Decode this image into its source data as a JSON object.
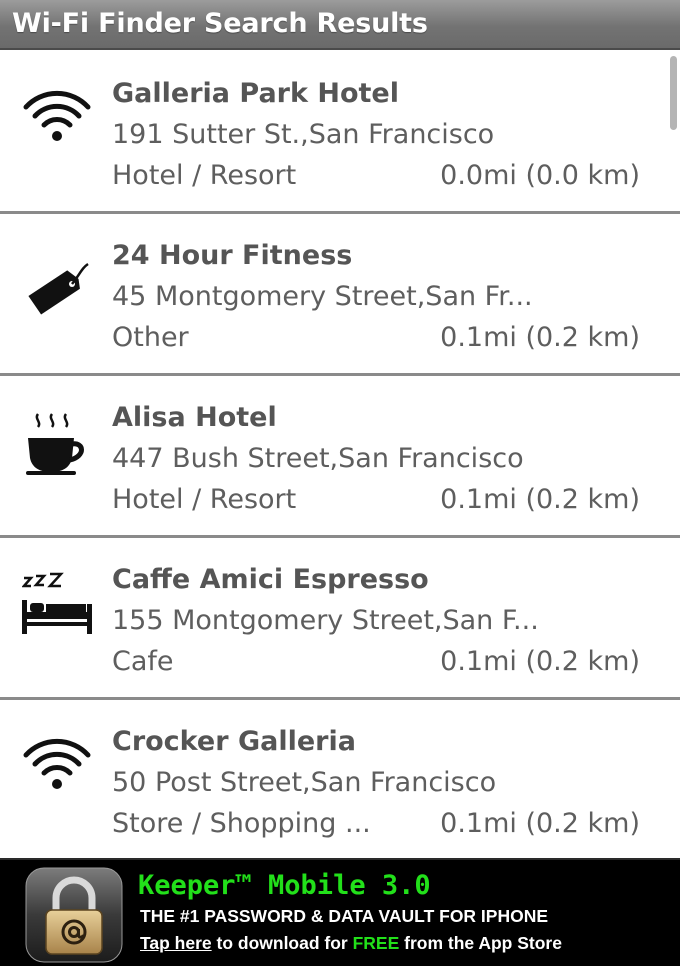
{
  "header": {
    "title": "Wi-Fi Finder Search Results"
  },
  "results": [
    {
      "icon": "wifi-icon",
      "name": "Galleria Park Hotel",
      "address": "191 Sutter St.,San Francisco",
      "category": "Hotel / Resort",
      "distance": "0.0mi (0.0 km)"
    },
    {
      "icon": "tag-icon",
      "name": "24 Hour Fitness",
      "address": "45 Montgomery Street,San Fr...",
      "category": "Other",
      "distance": "0.1mi (0.2 km)"
    },
    {
      "icon": "coffee-cup-icon",
      "name": "Alisa Hotel",
      "address": "447 Bush Street,San Francisco",
      "category": "Hotel / Resort",
      "distance": "0.1mi (0.2 km)"
    },
    {
      "icon": "bed-sleep-icon",
      "name": "Caffe Amici Espresso",
      "address": "155 Montgomery Street,San F...",
      "category": "Cafe",
      "distance": "0.1mi (0.2 km)"
    },
    {
      "icon": "wifi-icon",
      "name": "Crocker Galleria",
      "address": "50 Post Street,San Francisco",
      "category": "Store / Shopping ...",
      "distance": "0.1mi (0.2 km)"
    }
  ],
  "ad": {
    "headline": "Keeper™ Mobile 3.0",
    "tagline": "THE #1 PASSWORD & DATA VAULT FOR IPHONE",
    "cta_tap": "Tap here",
    "cta_middle": " to download for ",
    "cta_free": "FREE",
    "cta_end": " from the App Store",
    "logo_icon": "padlock-at-icon"
  },
  "colors": {
    "title_bar": "#7a7a7a",
    "text": "#5e5e5e",
    "ad_background": "#000000",
    "ad_accent": "#22e01a"
  }
}
